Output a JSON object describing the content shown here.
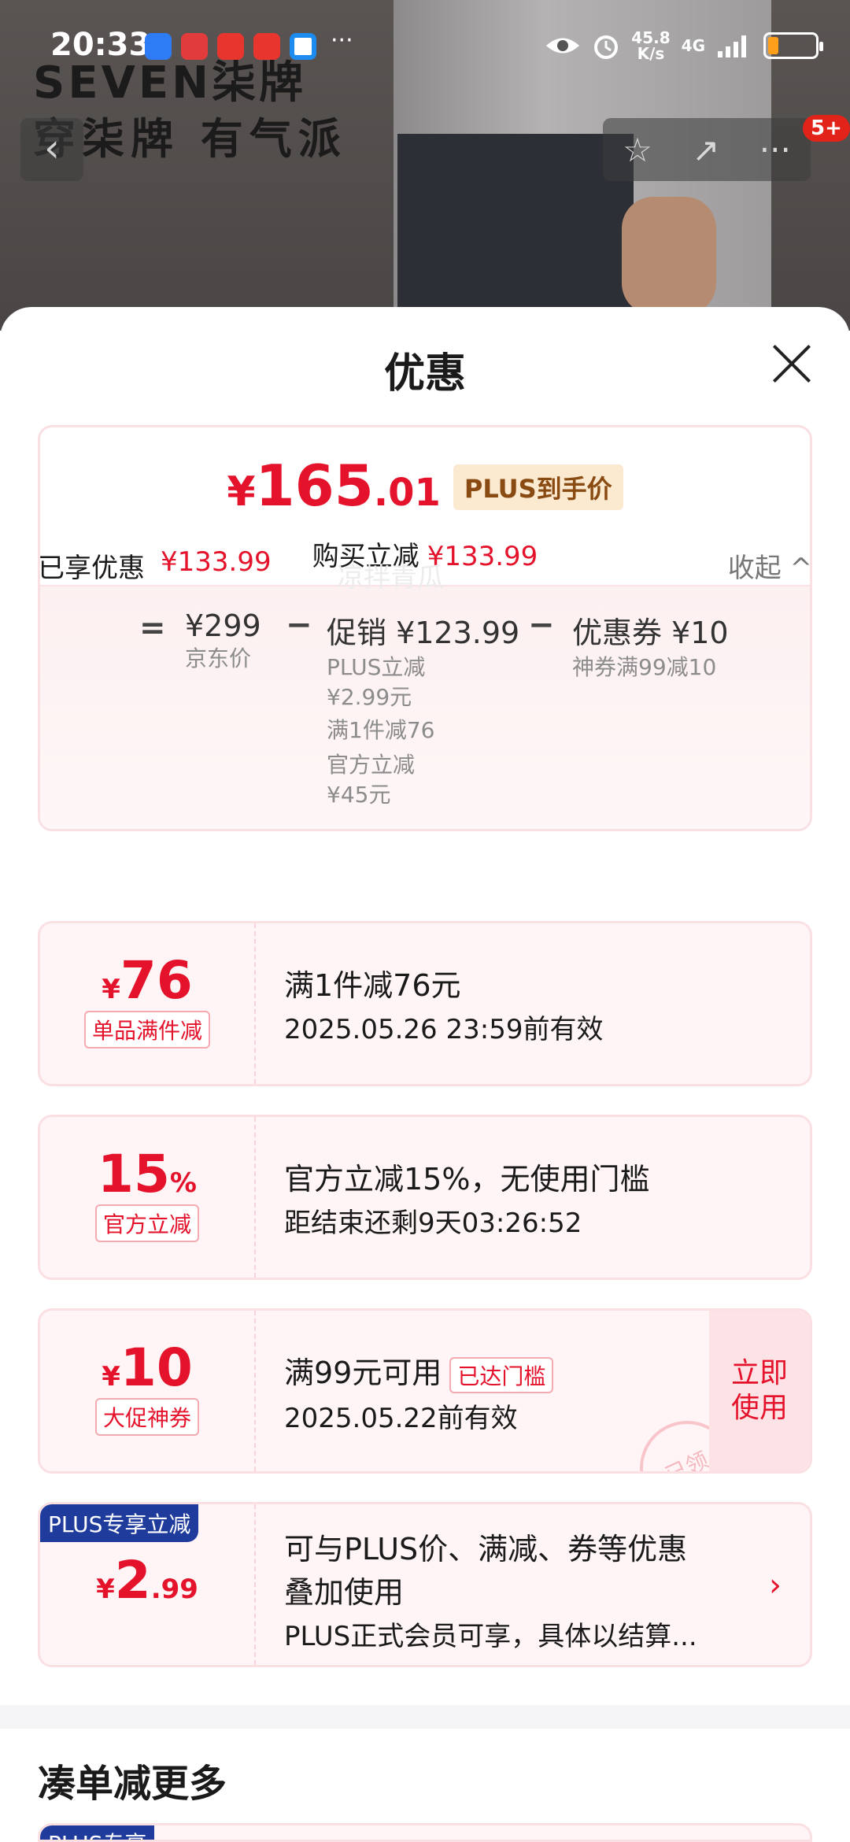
{
  "status_bar": {
    "time": "20:33",
    "speed": "45.8\nK/s",
    "network": "4G"
  },
  "brand": {
    "logo": "SEVEN柒牌",
    "slogan": "穿柒牌 有气派"
  },
  "nav": {
    "back": "‹",
    "star": "☆",
    "share": "↗",
    "more": "···",
    "badge": "5+"
  },
  "sheet": {
    "title": "优惠"
  },
  "summary": {
    "price_yen": "¥",
    "price_int": "165",
    "price_dec": ".01",
    "plus_tag": "PLUS到手价",
    "cut_label": "购买立减",
    "cut_value": "¥133.99",
    "eq": "=",
    "jd_price": "¥299",
    "jd_label": "京东价",
    "minus1": "−",
    "promo": "促销 ¥123.99",
    "promo_items": [
      "PLUS立减",
      "¥2.99元",
      "满1件减76",
      "官方立减",
      "¥45元"
    ],
    "minus2": "−",
    "coupon": "优惠券 ¥10",
    "coupon_desc": "神券满99减10"
  },
  "enjoyed": {
    "label": "已享优惠",
    "value": "¥133.99",
    "collapse": "收起 ^",
    "watermark": "凉拌青瓜"
  },
  "cards": [
    {
      "amt_prefix": "¥",
      "amt": "76",
      "amt_suffix": "",
      "tag": "单品满件减",
      "line1": "满1件减76元",
      "line2": "2025.05.26 23:59前有效"
    },
    {
      "amt_prefix": "",
      "amt": "15",
      "amt_suffix": "%",
      "tag": "官方立减",
      "line1": "官方立减15%，无使用门槛",
      "line2": "距结束还剩9天03:26:52"
    },
    {
      "amt_prefix": "¥",
      "amt": "10",
      "amt_suffix": "",
      "tag": "大促神券",
      "line1": "满99元可用",
      "met": "已达门槛",
      "line2": "2025.05.22前有效",
      "use": "立即\n使用",
      "stamp": "已领"
    },
    {
      "corner": "PLUS专享立减",
      "amt_prefix": "¥",
      "amt": "2",
      "amt_suffix": ".99",
      "line1": "可与PLUS价、满减、券等优惠",
      "line1b": "叠加使用",
      "line2": "PLUS正式会员可享，具体以结算...",
      "chevron": "›"
    }
  ],
  "more": {
    "title": "凑单减更多",
    "corner": "PLUS专享"
  },
  "colors": {
    "accent": "#e4132b",
    "plus_blue": "#1f3c9c",
    "card_bg": "#fff5f6"
  }
}
